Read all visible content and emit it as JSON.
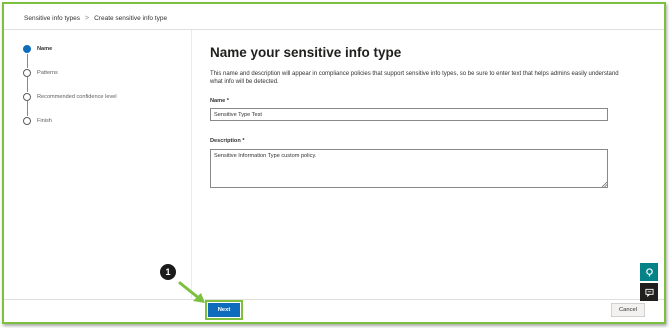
{
  "breadcrumb": {
    "items": [
      "Sensitive info types",
      "Create sensitive info type"
    ],
    "separator": ">"
  },
  "steps": [
    {
      "label": "Name",
      "active": true
    },
    {
      "label": "Patterns",
      "active": false
    },
    {
      "label": "Recommended confidence level",
      "active": false
    },
    {
      "label": "Finish",
      "active": false
    }
  ],
  "main": {
    "title": "Name your sensitive info type",
    "description": "This name and description will appear in compliance policies that support sensitive info types, so be sure to enter text that helps admins easily understand what info will be detected.",
    "name_label": "Name *",
    "name_value": "Sensitive Type Test",
    "description_label": "Description *",
    "description_value": "Sensitive Information Type custom policy."
  },
  "footer": {
    "next_label": "Next",
    "cancel_label": "Cancel"
  },
  "callout": {
    "number": "1"
  },
  "icons": {
    "help": "help-icon",
    "chat": "chat-icon"
  },
  "colors": {
    "accent": "#0f6cbd",
    "highlight_border": "#7dc03f",
    "help_button": "#038387"
  }
}
